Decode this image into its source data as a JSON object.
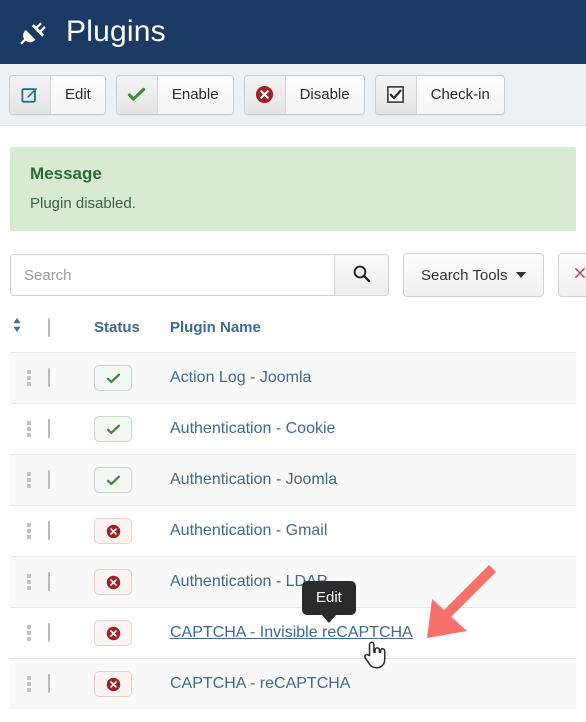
{
  "header": {
    "title": "Plugins",
    "icon": "plug-icon",
    "background_color": "#1b3a63"
  },
  "toolbar": {
    "buttons": [
      {
        "label": "Edit",
        "icon": "pencil-square-icon",
        "icon_color": "#1e6a8c"
      },
      {
        "label": "Enable",
        "icon": "check-icon",
        "icon_color": "#3c8c3c"
      },
      {
        "label": "Disable",
        "icon": "circle-x-icon",
        "icon_color": "#9b2226"
      },
      {
        "label": "Check-in",
        "icon": "checkbox-checked-icon",
        "icon_color": "#2b2b2b"
      }
    ]
  },
  "message": {
    "title": "Message",
    "text": "Plugin disabled.",
    "background_color": "#d9ead3",
    "text_color": "#2c6b2f"
  },
  "search": {
    "placeholder": "Search",
    "value": "",
    "search_icon": "magnifier-icon",
    "tools_label": "Search Tools",
    "tools_caret": "chevron-down-icon",
    "clear_icon": "clear-icon"
  },
  "table": {
    "columns": {
      "ordering": "ordering-sort-icon",
      "check_all": "select-all-checkbox",
      "status": "Status",
      "plugin_name": "Plugin Name"
    },
    "rows": [
      {
        "name": "Action Log - Joomla",
        "status": "enabled",
        "checked": false,
        "hovered": false
      },
      {
        "name": "Authentication - Cookie",
        "status": "enabled",
        "checked": false,
        "hovered": false
      },
      {
        "name": "Authentication - Joomla",
        "status": "enabled",
        "checked": false,
        "hovered": false
      },
      {
        "name": "Authentication - Gmail",
        "status": "disabled",
        "checked": false,
        "hovered": false
      },
      {
        "name": "Authentication - LDAP",
        "status": "disabled",
        "checked": false,
        "hovered": false
      },
      {
        "name": "CAPTCHA - Invisible reCAPTCHA",
        "status": "disabled",
        "checked": false,
        "hovered": true
      },
      {
        "name": "CAPTCHA - reCAPTCHA",
        "status": "disabled",
        "checked": false,
        "hovered": false
      }
    ]
  },
  "tooltip": {
    "text": "Edit"
  },
  "annotations": {
    "arrow_color": "#f9706b",
    "cursor": "pointer-hand-cursor"
  }
}
